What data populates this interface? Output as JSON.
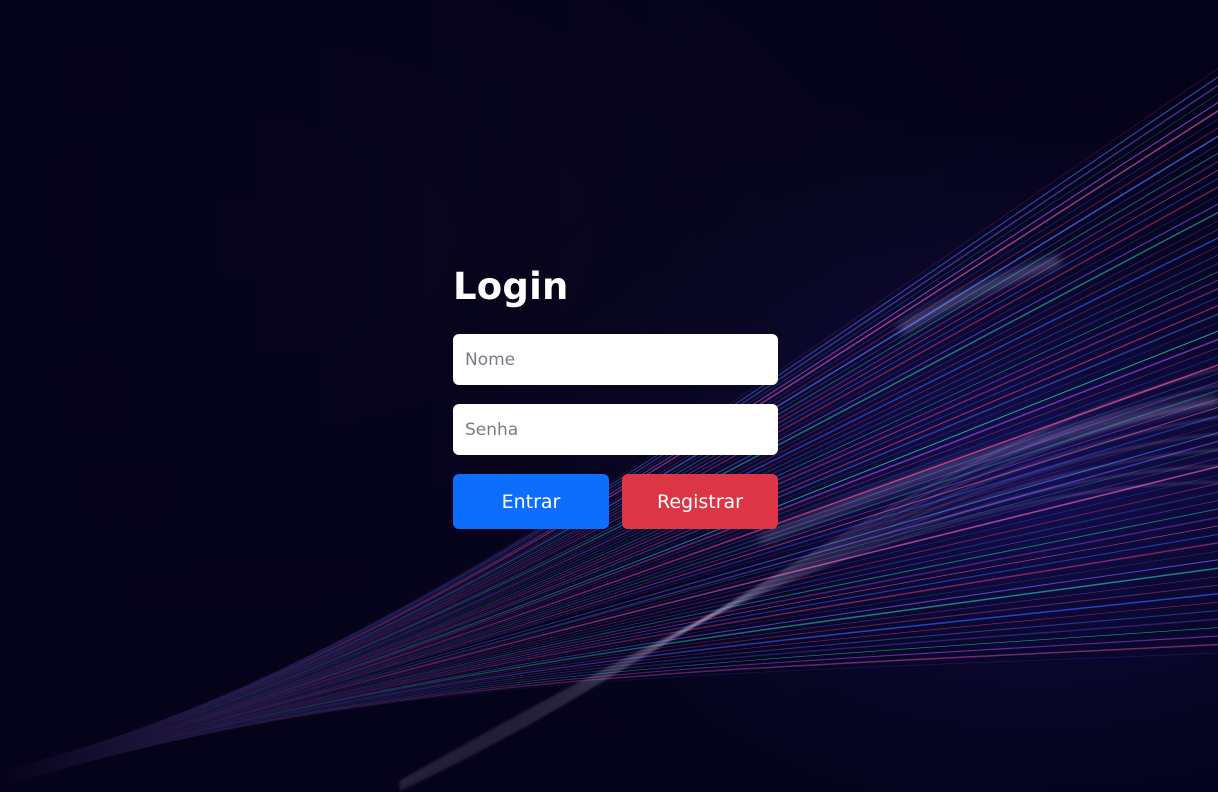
{
  "login": {
    "title": "Login",
    "name_placeholder": "Nome",
    "password_placeholder": "Senha",
    "enter_label": "Entrar",
    "register_label": "Registrar"
  },
  "colors": {
    "background": "#06041a",
    "enter_button": "#0d6efd",
    "register_button": "#dc3545",
    "title_text": "#ffffff"
  },
  "icons": [
    "light-streaks-background"
  ]
}
